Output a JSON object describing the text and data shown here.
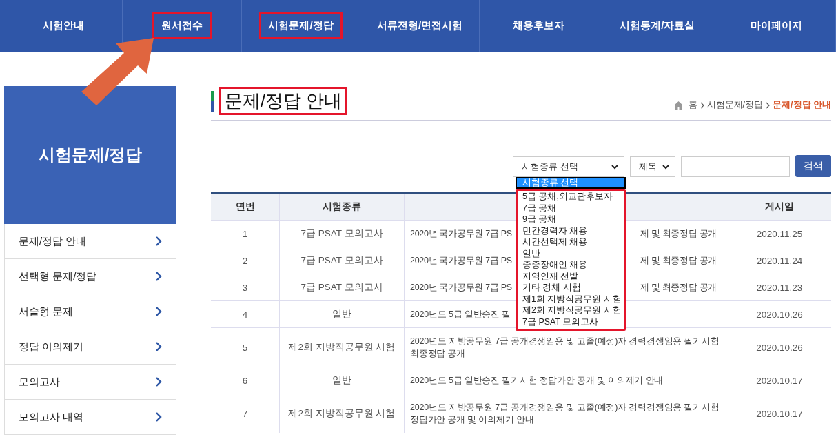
{
  "nav": [
    {
      "label": "시험안내",
      "highlighted": false
    },
    {
      "label": "원서접수",
      "highlighted": true
    },
    {
      "label": "시험문제/정답",
      "highlighted": true
    },
    {
      "label": "서류전형/면접시험",
      "highlighted": false
    },
    {
      "label": "채용후보자",
      "highlighted": false
    },
    {
      "label": "시험통계/자료실",
      "highlighted": false
    },
    {
      "label": "마이페이지",
      "highlighted": false
    }
  ],
  "sidebar": {
    "title": "시험문제/정답",
    "items": [
      {
        "label": "문제/정답 안내"
      },
      {
        "label": "선택형 문제/정답"
      },
      {
        "label": "서술형 문제"
      },
      {
        "label": "정답 이의제기"
      },
      {
        "label": "모의고사"
      },
      {
        "label": "모의고사 내역"
      }
    ]
  },
  "page": {
    "title": "문제/정답 안내",
    "title_highlighted": true,
    "breadcrumb": [
      {
        "label": "홈",
        "current": false
      },
      {
        "label": "시험문제/정답",
        "current": false
      },
      {
        "label": "문제/정답 안내",
        "current": true
      }
    ]
  },
  "search": {
    "category": "시험종류 선택",
    "field": "제목",
    "button": "검색"
  },
  "dropdown": {
    "options": [
      {
        "label": "시험종류 선택",
        "selected": true,
        "highlighted": false
      },
      {
        "label": "5급 공채,외교관후보자",
        "selected": false,
        "highlighted": true
      },
      {
        "label": "7급 공채",
        "selected": false,
        "highlighted": true
      },
      {
        "label": "9급 공채",
        "selected": false,
        "highlighted": true
      },
      {
        "label": "민간경력자 채용",
        "selected": false,
        "highlighted": true
      },
      {
        "label": "시간선택제 채용",
        "selected": false,
        "highlighted": true
      },
      {
        "label": "일반",
        "selected": false,
        "highlighted": true
      },
      {
        "label": "중증장애인 채용",
        "selected": false,
        "highlighted": true
      },
      {
        "label": "지역인재 선발",
        "selected": false,
        "highlighted": true
      },
      {
        "label": "기타 경채 시험",
        "selected": false,
        "highlighted": true
      },
      {
        "label": "제1회 지방직공무원 시험",
        "selected": false,
        "highlighted": true
      },
      {
        "label": "제2회 지방직공무원 시험",
        "selected": false,
        "highlighted": true
      },
      {
        "label": "7급 PSAT 모의고사",
        "selected": false,
        "highlighted": true
      }
    ]
  },
  "table": {
    "columns": [
      "연번",
      "시험종류",
      "",
      "게시일"
    ],
    "rows": [
      {
        "no": "1",
        "type": "7급 PSAT 모의고사",
        "title": [
          "2020년 국가공무원 7급 PS",
          "제 및 최종정답 공개"
        ],
        "date": "2020.11.25"
      },
      {
        "no": "2",
        "type": "7급 PSAT 모의고사",
        "title": [
          "2020년 국가공무원 7급 PS",
          "제 및 최종정답 공개"
        ],
        "date": "2020.11.24"
      },
      {
        "no": "3",
        "type": "7급 PSAT 모의고사",
        "title": [
          "2020년 국가공무원 7급 PS",
          "제 및 최종정답 공개"
        ],
        "date": "2020.11.23"
      },
      {
        "no": "4",
        "type": "일반",
        "title": [
          "2020년도 5급 일반승진 필"
        ],
        "date": "2020.10.26"
      },
      {
        "no": "5",
        "type": "제2회 지방직공무원 시험",
        "title": [
          "2020년도 지방공무원 7급 공개경쟁임용 및 고졸(예정)자 경력경쟁임용 필기시험 최종정답 공개"
        ],
        "date": "2020.10.26"
      },
      {
        "no": "6",
        "type": "일반",
        "title": [
          "2020년도 5급 일반승진 필기시험 정답가안 공개 및 이의제기 안내"
        ],
        "date": "2020.10.17"
      },
      {
        "no": "7",
        "type": "제2회 지방직공무원 시험",
        "title": [
          "2020년도 지방공무원 7급 공개경쟁임용 및 고졸(예정)자 경력경쟁임용 필기시험 정답가안 공개 및 이의제기 안내"
        ],
        "date": "2020.10.17"
      }
    ]
  }
}
